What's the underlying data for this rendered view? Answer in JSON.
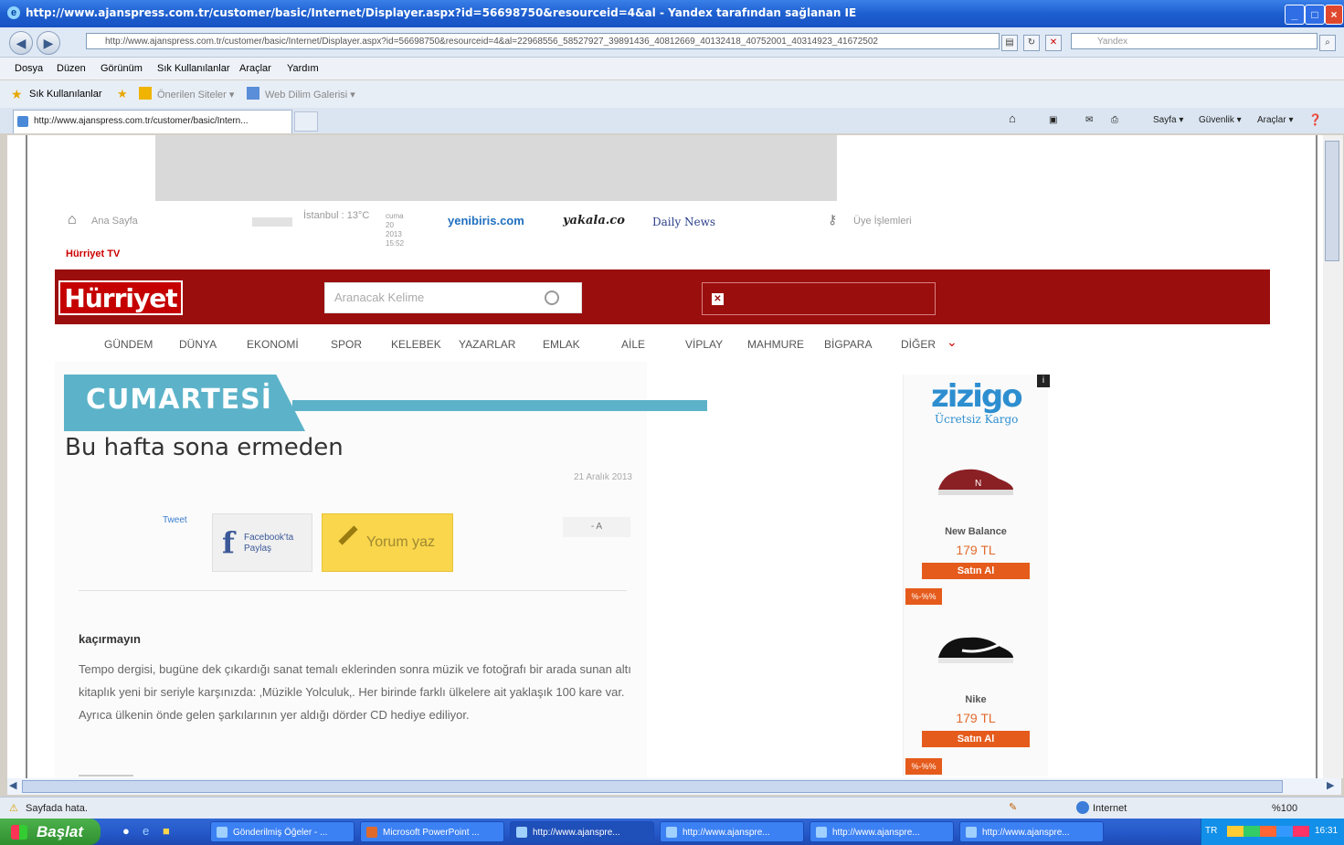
{
  "window": {
    "title": "http://www.ajanspress.com.tr/customer/basic/Internet/Displayer.aspx?id=56698750&resourceid=4&al - Yandex tarafından sağlanan IE",
    "controls": [
      "_",
      "□",
      "×"
    ]
  },
  "address": {
    "url": "http://www.ajanspress.com.tr/customer/basic/Internet/Displayer.aspx?id=56698750&resourceid=4&al=22968556_58527927_39891436_40812669_40132418_40752001_40314923_41672502",
    "search_placeholder": "Yandex"
  },
  "menu": [
    "Dosya",
    "Düzen",
    "Görünüm",
    "Sık Kullanılanlar",
    "Araçlar",
    "Yardım"
  ],
  "favorites": {
    "label": "Sık Kullanılanlar",
    "items": [
      "Önerilen Siteler ▾",
      "Web Dilim Galerisi ▾"
    ]
  },
  "tab": {
    "title": "http://www.ajanspress.com.tr/customer/basic/Intern..."
  },
  "commandbar": [
    "Sayfa ▾",
    "Güvenlik ▾",
    "Araçlar ▾"
  ],
  "site": {
    "top_links": {
      "home": "Ana Sayfa",
      "weather": "İstanbul : 13°C",
      "date_block": "cuma 20 2013 15:52",
      "partner1": "yenibiris.com",
      "partner2": "yakala.co",
      "partner3": "Daily News",
      "member": "Üye İşlemleri",
      "tv": "Hürriyet TV"
    },
    "logo": "Hürriyet",
    "search_placeholder": "Aranacak Kelime",
    "nav": [
      "GÜNDEM",
      "DÜNYA",
      "EKONOMİ",
      "SPOR",
      "KELEBEK",
      "YAZARLAR",
      "EMLAK",
      "AİLE",
      "VİPLAY",
      "MAHMURE",
      "BİGPARA",
      "DİĞER"
    ]
  },
  "article": {
    "section": "CUMARTESİ",
    "headline": "Bu hafta sona ermeden",
    "date": "21 Aralık 2013",
    "tweet": "Tweet",
    "facebook": "Facebook'ta Paylaş",
    "comment": "Yorum yaz",
    "font_controls": "- A",
    "subhead": "kaçırmayın",
    "body": "Tempo dergisi, bugüne dek çıkardığı sanat temalı eklerinden sonra müzik ve fotoğrafı bir arada sunan altı kitaplık yeni bir seriyle karşınızda: ‚Müzikle Yolculuk‚. Her birinde farklı ülkelere ait yaklaşık 100 kare var. Ayrıca ülkenin önde gelen şarkılarının yer aldığı dörder CD hediye ediliyor."
  },
  "ad": {
    "brand": "zizigo",
    "tagline": "Ücretsiz Kargo",
    "close": "i",
    "products": [
      {
        "name": "New Balance",
        "price": "179 TL",
        "button": "Satın Al",
        "color": "#8a1f24"
      },
      {
        "name": "Nike",
        "price": "179 TL",
        "button": "Satın Al",
        "color": "#111111"
      }
    ],
    "discount": "%-%%"
  },
  "status": {
    "left": "Sayfada hata.",
    "zone": "Internet",
    "zoom": "%100"
  },
  "taskbar": {
    "start": "Başlat",
    "tasks": [
      "Gönderilmiş Öğeler - ...",
      "Microsoft PowerPoint ...",
      "http://www.ajanspre...",
      "http://www.ajanspre...",
      "http://www.ajanspre...",
      "http://www.ajanspre..."
    ],
    "lang": "TR",
    "clock": "16:31"
  }
}
